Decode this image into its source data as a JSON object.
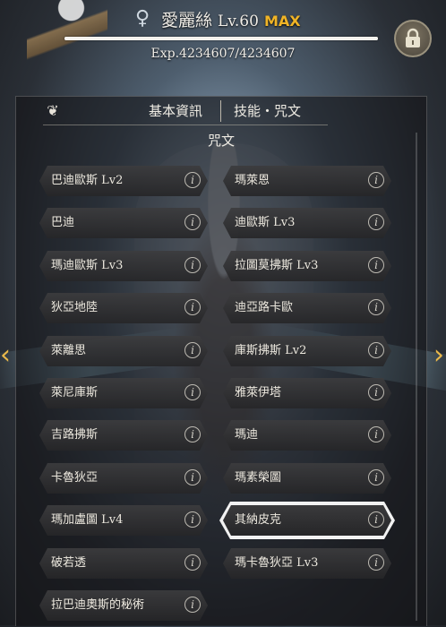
{
  "header": {
    "gender_icon": "female-symbol-icon",
    "gender_glyph": "♀",
    "character_name": "愛麗絲",
    "level": "Lv.60",
    "max_label": "MAX",
    "exp_text": "Exp.4234607/4234607",
    "exp_progress": 1.0,
    "lock_icon": "lock-icon"
  },
  "nav": {
    "left_arrow": "‹",
    "right_arrow": "›"
  },
  "tabs": {
    "icon": "emblem-icon",
    "icon_glyph": "❦",
    "basic_info": "基本資訊",
    "skills_spells": "技能・咒文"
  },
  "section_title": "咒文",
  "spells": {
    "left": [
      "巴迪歐斯 Lv2",
      "巴迪",
      "瑪迪歐斯 Lv3",
      "狄亞地陸",
      "萊離思",
      "萊尼庫斯",
      "吉路拂斯",
      "卡魯狄亞",
      "瑪加盧圖 Lv4",
      "破若透",
      "拉巴迪奧斯的秘術"
    ],
    "right": [
      "瑪萊恩",
      "迪歐斯 Lv3",
      "拉圖莫拂斯 Lv3",
      "迪亞路卡歐",
      "庫斯拂斯 Lv2",
      "雅萊伊塔",
      "瑪迪",
      "瑪素榮圖",
      "其納皮克",
      "瑪卡魯狄亞 Lv3"
    ],
    "selected": "其納皮克",
    "info_glyph": "i"
  },
  "colors": {
    "max": "#f0b426",
    "arrow": "#e9b84a",
    "panel_bg": "#141416"
  }
}
